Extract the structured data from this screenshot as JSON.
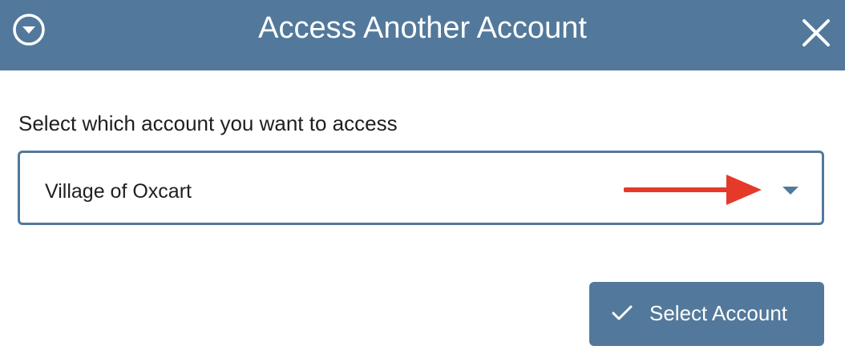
{
  "dialog": {
    "title": "Access Another Account",
    "collapse_icon": "chevron-down-circle-icon",
    "close_icon": "close-icon",
    "header_color": "#52799b"
  },
  "form": {
    "prompt": "Select which account you want to access",
    "account_select": {
      "selected_value": "Village of Oxcart",
      "caret_icon": "caret-down-icon"
    }
  },
  "annotation": {
    "arrow_icon": "right-arrow-icon",
    "color": "#e53a2a"
  },
  "actions": {
    "select_account_label": "Select Account",
    "select_account_icon": "checkmark-icon"
  }
}
